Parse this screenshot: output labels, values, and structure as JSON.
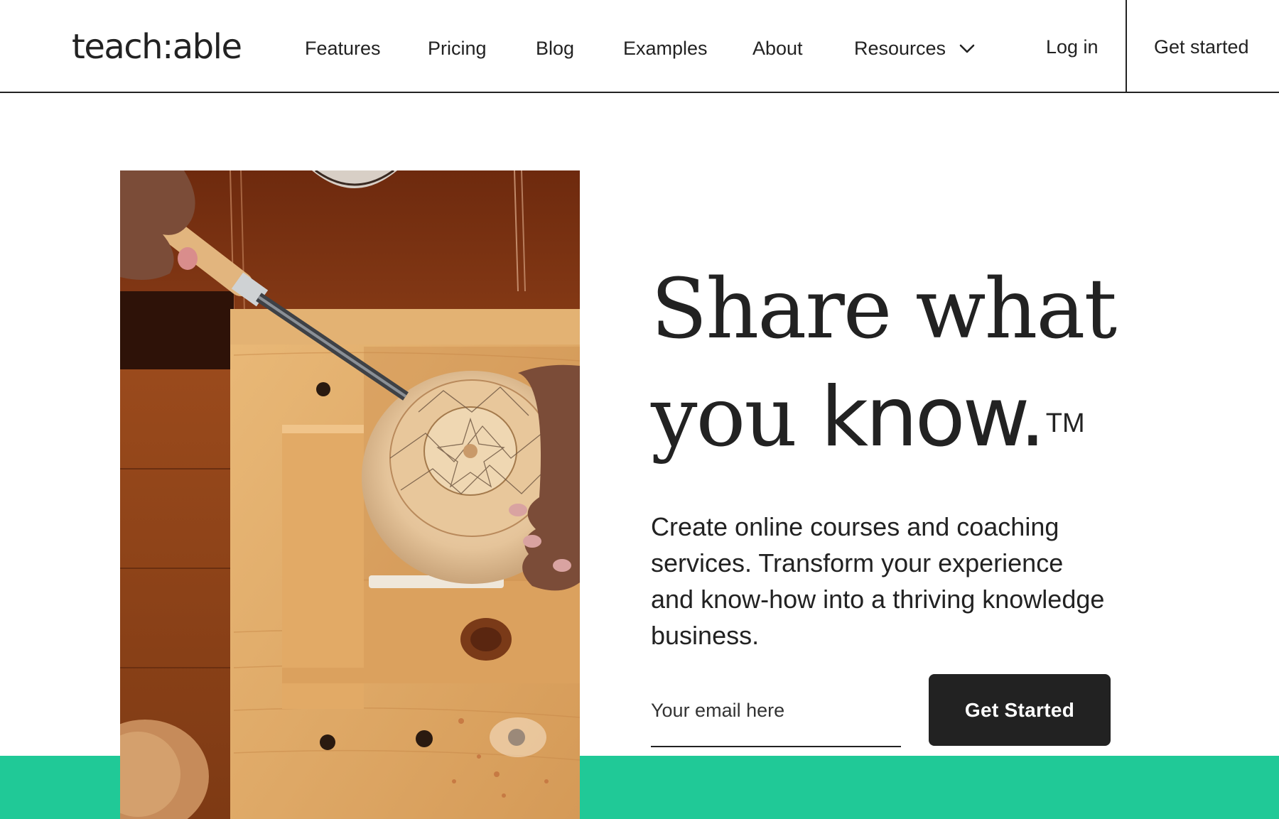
{
  "brand": {
    "logo_text": "teach:able"
  },
  "nav": {
    "items": [
      {
        "label": "Features"
      },
      {
        "label": "Pricing"
      },
      {
        "label": "Blog"
      },
      {
        "label": "Examples"
      },
      {
        "label": "About"
      },
      {
        "label": "Resources",
        "has_dropdown": true,
        "icon": "chevron-down-icon"
      }
    ],
    "login_label": "Log in",
    "get_started_label": "Get started"
  },
  "hero": {
    "headline_line1": "Share what",
    "headline_line2_serif": "you",
    "headline_line2_bold": "know.",
    "trademark": "TM",
    "subtitle": "Create online courses and coaching services. Transform your experience and know-how into a thriving knowledge business.",
    "email_placeholder": "Your email here",
    "cta_label": "Get Started",
    "image_alt": "Hands carving a wooden bowl with a chisel"
  },
  "colors": {
    "text": "#222222",
    "accent_green": "#20c997",
    "button_bg": "#222222",
    "button_text": "#ffffff"
  }
}
